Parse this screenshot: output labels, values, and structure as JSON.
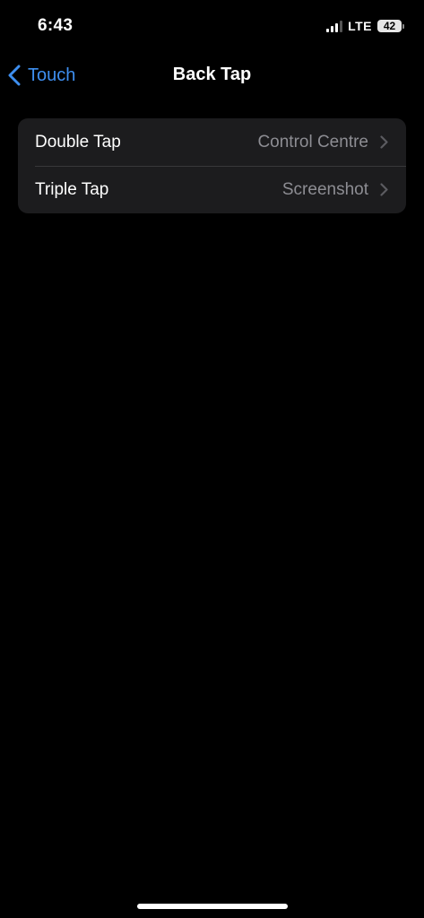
{
  "status_bar": {
    "time": "6:43",
    "carrier": "LTE",
    "battery_level": "42",
    "signal_bars_active": 3,
    "signal_bars_total": 4
  },
  "nav": {
    "back_label": "Touch",
    "title": "Back Tap"
  },
  "settings": {
    "rows": [
      {
        "label": "Double Tap",
        "value": "Control Centre",
        "icon": "chevron-right-icon"
      },
      {
        "label": "Triple Tap",
        "value": "Screenshot",
        "icon": "chevron-right-icon"
      }
    ]
  },
  "colors": {
    "background": "#000000",
    "cell_background": "#1c1c1e",
    "accent": "#3e8ff0",
    "secondary_text": "#8d8d93"
  }
}
